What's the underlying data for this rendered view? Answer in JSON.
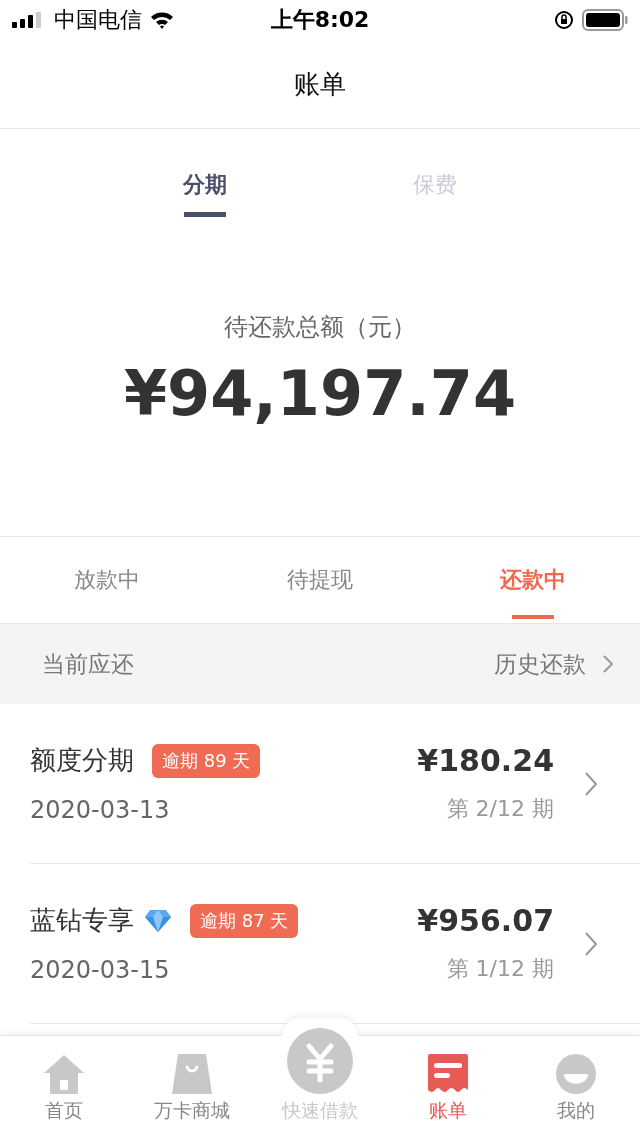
{
  "status_bar": {
    "carrier": "中国电信",
    "time": "上午8:02"
  },
  "nav": {
    "title": "账单"
  },
  "product_tabs": [
    {
      "label": "分期",
      "selected": true
    },
    {
      "label": "保费",
      "selected": false
    }
  ],
  "summary": {
    "label": "待还款总额（元）",
    "amount": "¥94,197.74"
  },
  "loan_tabs": [
    {
      "label": "放款中",
      "selected": false
    },
    {
      "label": "待提现",
      "selected": false
    },
    {
      "label": "还款中",
      "selected": true
    }
  ],
  "section": {
    "title": "当前应还",
    "link": "历史还款"
  },
  "bills": [
    {
      "name": "额度分期",
      "diamond": false,
      "badge": "逾期 89 天",
      "date": "2020-03-13",
      "amount": "¥180.24",
      "period": "第 2/12 期"
    },
    {
      "name": "蓝钻专享",
      "diamond": true,
      "badge": "逾期 87 天",
      "date": "2020-03-15",
      "amount": "¥956.07",
      "period": "第 1/12 期"
    }
  ],
  "tab_bar": [
    {
      "kind": "home",
      "label": "首页",
      "selected": false
    },
    {
      "kind": "shop",
      "label": "万卡商城",
      "selected": false
    },
    {
      "kind": "loan",
      "label": "快速借款",
      "selected": false
    },
    {
      "kind": "bill",
      "label": "账单",
      "selected": true
    },
    {
      "kind": "me",
      "label": "我的",
      "selected": false
    }
  ]
}
